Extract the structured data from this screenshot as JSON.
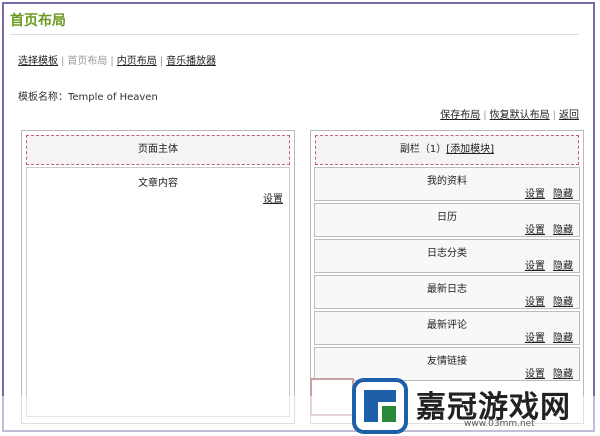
{
  "header": {
    "title": "首页布局"
  },
  "nav": {
    "items": [
      {
        "label": "选择模板",
        "current": false
      },
      {
        "label": "首页布局",
        "current": true
      },
      {
        "label": "内页布局",
        "current": false
      },
      {
        "label": "音乐播放器",
        "current": false
      }
    ]
  },
  "template": {
    "label": "模板名称：",
    "name": "Temple of Heaven"
  },
  "actions": {
    "save": "保存布局",
    "restore": "恢复默认布局",
    "back": "返回"
  },
  "left_column": {
    "header": "页面主体",
    "block": {
      "title": "文章内容",
      "setting": "设置"
    }
  },
  "right_column": {
    "header_prefix": "副栏（1）",
    "add_module": "[添加模块]",
    "modules": [
      {
        "title": "我的资料",
        "setting": "设置",
        "hide": "隐藏"
      },
      {
        "title": "日历",
        "setting": "设置",
        "hide": "隐藏"
      },
      {
        "title": "日志分类",
        "setting": "设置",
        "hide": "隐藏"
      },
      {
        "title": "最新日志",
        "setting": "设置",
        "hide": "隐藏"
      },
      {
        "title": "最新评论",
        "setting": "设置",
        "hide": "隐藏"
      },
      {
        "title": "友情链接",
        "setting": "设置",
        "hide": "隐藏"
      }
    ]
  },
  "watermark": {
    "text": "嘉冠游戏网",
    "url": "www.03mm.net",
    "logo_color": "#2a8a3a"
  }
}
